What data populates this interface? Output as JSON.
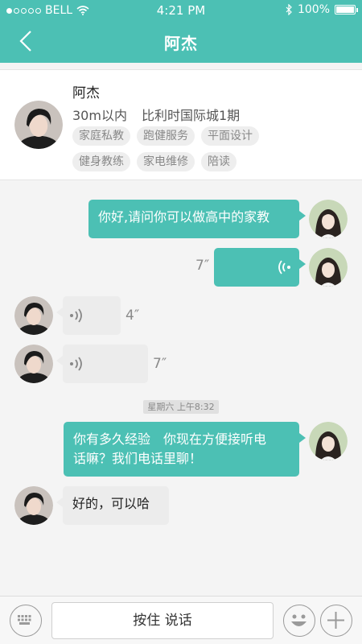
{
  "status_bar": {
    "carrier": "BELL",
    "time": "4:21 PM",
    "battery": "100%"
  },
  "nav": {
    "title": "阿杰"
  },
  "profile": {
    "name": "阿杰",
    "distance": "30m以内",
    "location": "比利时国际城1期",
    "tags": [
      "家庭私教",
      "跑健服务",
      "平面设计",
      "健身教练",
      "家电维修",
      "陪读"
    ]
  },
  "messages": {
    "m1": "你好,请问你可以做高中的家教",
    "m2_duration": "7″",
    "m3_duration": "4″",
    "m4_duration": "7″",
    "timestamp": "星期六 上午8:32",
    "m5_line1": "你有多久经验　你现在方便接听电",
    "m5_line2": "话嘛？我们电话里聊！",
    "m6": "好的，可以哈"
  },
  "input_bar": {
    "hold_to_talk": "按住 说话"
  },
  "colors": {
    "accent": "#4cc0b4",
    "incoming_bubble": "#ececec"
  }
}
